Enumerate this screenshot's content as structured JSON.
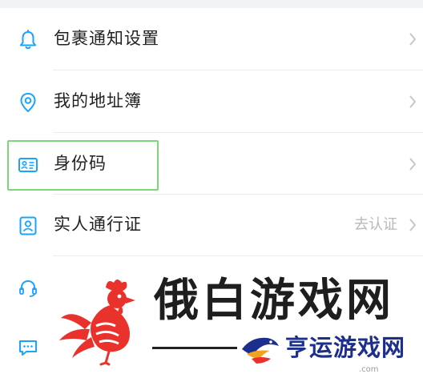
{
  "menu": {
    "items": [
      {
        "label": "包裹通知设置",
        "icon": "bell-icon"
      },
      {
        "label": "我的地址簿",
        "icon": "location-pin-icon"
      },
      {
        "label": "身份码",
        "icon": "id-card-icon"
      },
      {
        "label": "实人通行证",
        "icon": "person-badge-icon",
        "status": "去认证"
      },
      {
        "label": "",
        "icon": "headset-icon"
      },
      {
        "label": "",
        "icon": "chat-bubble-icon"
      }
    ]
  },
  "watermark": {
    "title": "俄白游戏网",
    "subtitle": "亨运游戏网",
    "domain": ".com"
  },
  "colors": {
    "icon_blue": "#1aa3ff",
    "highlight_green": "#7cd67a",
    "watermark_red": "#e8322b",
    "watermark_navy": "#1d2f8c",
    "watermark_orange": "#f2a21b"
  }
}
